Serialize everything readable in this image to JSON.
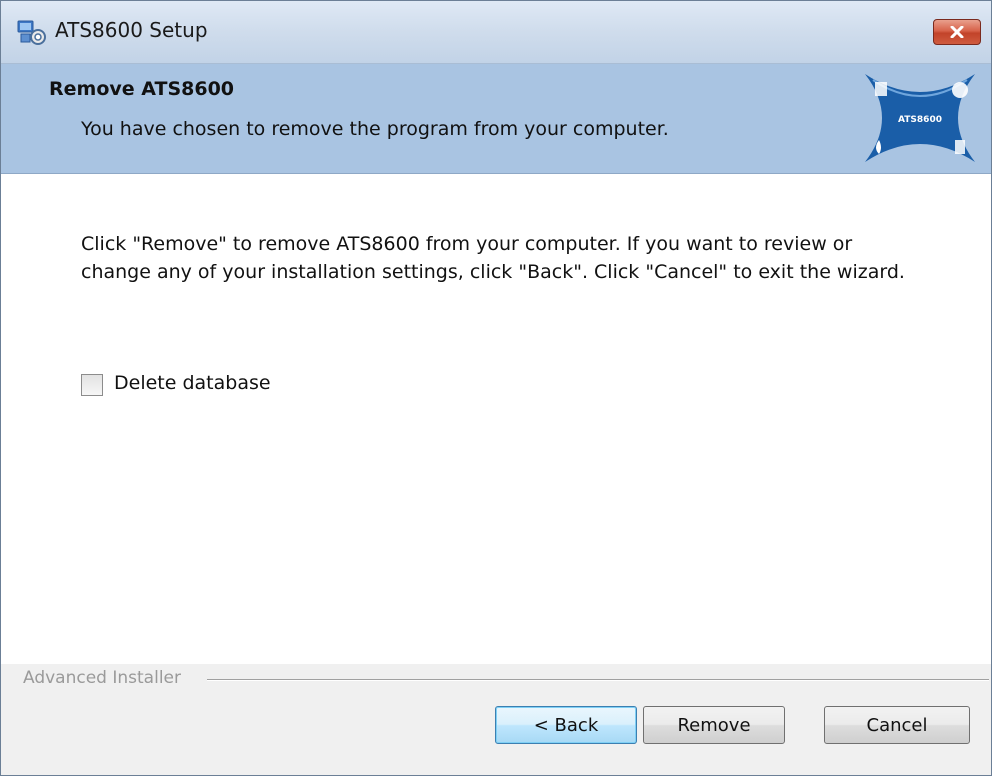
{
  "window": {
    "title": "ATS8600 Setup",
    "close_icon": "close-icon"
  },
  "header": {
    "title": "Remove ATS8600",
    "subtitle": "You have chosen to remove the program from your computer.",
    "logo_text": "ATS8600"
  },
  "content": {
    "instruction_line1": "Click \"Remove\" to remove ATS8600 from your computer.  If you want to review or",
    "instruction_line2": "change any of your installation settings, click \"Back\".  Click \"Cancel\" to exit the wizard.",
    "checkbox_label": "Delete database",
    "checkbox_checked": false
  },
  "footer": {
    "brand": "Advanced Installer",
    "back_label": "< Back",
    "remove_label": "Remove",
    "cancel_label": "Cancel"
  },
  "colors": {
    "header_bg": "#a9c4e2",
    "logo_blue": "#1a5ea8",
    "close_red": "#c9452c"
  }
}
